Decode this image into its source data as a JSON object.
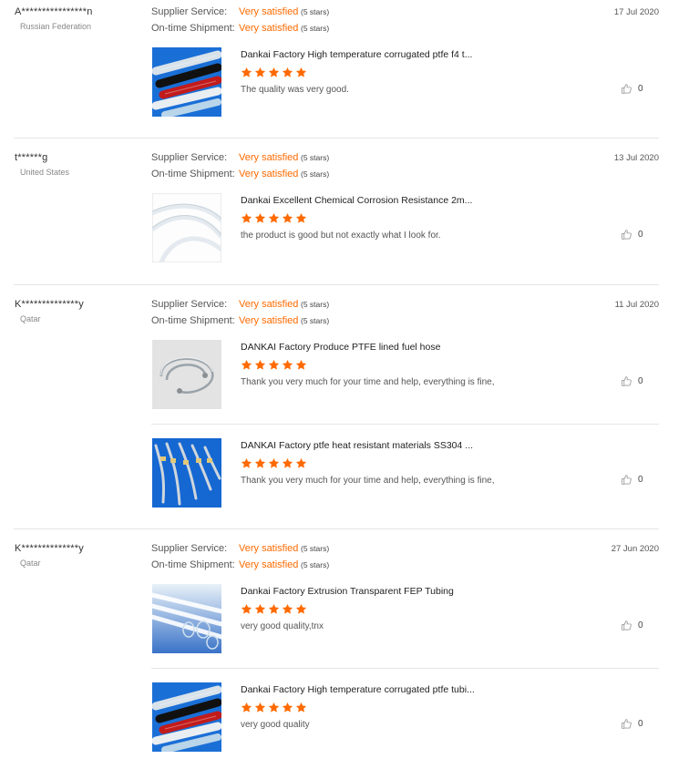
{
  "labels": {
    "supplier_service": "Supplier Service:",
    "ontime_shipment": "On-time Shipment:"
  },
  "reviews": [
    {
      "buyer": "A****************n",
      "country": "Russian Federation",
      "date": "17 Jul 2020",
      "supplier_service": "Very satisfied",
      "supplier_service_stars": "(5 stars)",
      "ontime_shipment": "Very satisfied",
      "ontime_shipment_stars": "(5 stars)",
      "items": [
        {
          "thumb": "ptfe-colored-tubes",
          "title": "Dankai Factory High temperature corrugated ptfe f4 t...",
          "rating": 5,
          "comment": "The quality was very good.",
          "likes": "0"
        }
      ]
    },
    {
      "buyer": "t******g",
      "country": "United States",
      "date": "13 Jul 2020",
      "supplier_service": "Very satisfied",
      "supplier_service_stars": "(5 stars)",
      "ontime_shipment": "Very satisfied",
      "ontime_shipment_stars": "(5 stars)",
      "items": [
        {
          "thumb": "white-tube-coil",
          "title": "Dankai Excellent Chemical Corrosion Resistance 2m...",
          "rating": 5,
          "comment": "the product is good but not exactly what I look for.",
          "likes": "0"
        }
      ]
    },
    {
      "buyer": "K**************y",
      "country": "Qatar",
      "date": "11 Jul 2020",
      "supplier_service": "Very satisfied",
      "supplier_service_stars": "(5 stars)",
      "ontime_shipment": "Very satisfied",
      "ontime_shipment_stars": "(5 stars)",
      "items": [
        {
          "thumb": "fuel-hose",
          "title": "DANKAI Factory Produce PTFE lined fuel hose",
          "rating": 5,
          "comment": "Thank you very much for your time and help, everything is fine,",
          "likes": "0"
        },
        {
          "thumb": "braided-hoses",
          "title": "DANKAI Factory ptfe heat resistant materials SS304 ...",
          "rating": 5,
          "comment": "Thank you very much for your time and help, everything is fine,",
          "likes": "0"
        }
      ]
    },
    {
      "buyer": "K**************y",
      "country": "Qatar",
      "date": "27 Jun 2020",
      "supplier_service": "Very satisfied",
      "supplier_service_stars": "(5 stars)",
      "ontime_shipment": "Very satisfied",
      "ontime_shipment_stars": "(5 stars)",
      "items": [
        {
          "thumb": "fep-tubing",
          "title": "Dankai Factory Extrusion Transparent FEP Tubing",
          "rating": 5,
          "comment": "very good quality,tnx",
          "likes": "0"
        },
        {
          "thumb": "ptfe-colored-tubes",
          "title": "Dankai Factory High temperature corrugated ptfe tubi...",
          "rating": 5,
          "comment": "very good quality",
          "likes": "0"
        }
      ]
    }
  ],
  "colors": {
    "accent": "#ff6a00",
    "star": "#ff6a00"
  }
}
